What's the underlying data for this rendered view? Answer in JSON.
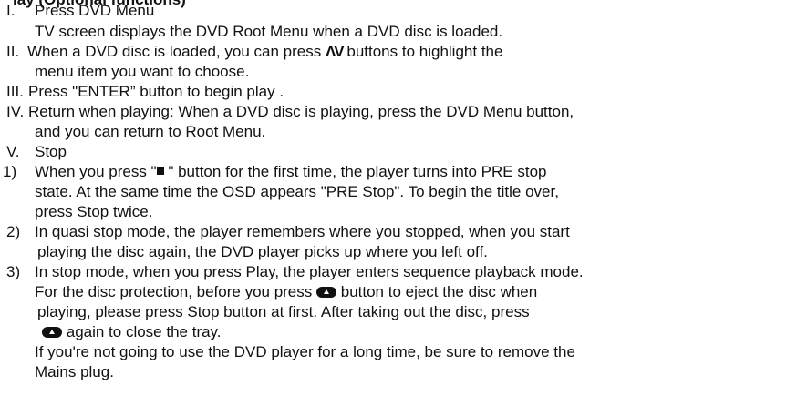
{
  "heading_fragment": "lay (Optional functions)",
  "lines": {
    "l1_num": "I.",
    "l1_text": "Press DVD Menu",
    "l2_text": "TV screen displays the DVD Root  Menu when a DVD disc is loaded.",
    "l3_num": "II.",
    "l3_a": "When a  DVD disc is loaded, you  can  press",
    "l3_icon": "ΛV",
    "l3_b": "buttons to highlight  the",
    "l4_text": "menu item you want  to choose.",
    "l5_num": "III.",
    "l5_text": "Press \"ENTER” button to begin play .",
    "l6_num": "IV.",
    "l6_text": "Return when playing: When a DVD disc is playing, press the  DVD Menu button,",
    "l7_text": "and you can return  to Root Menu.",
    "l8_num": "V.",
    "l8_text": "Stop",
    "l9_num": "1)",
    "l9_a": "When you press \"",
    "l9_b": " \" button for the first time, the player turns into PRE stop",
    "l10_text": "state. At the same  time the  OSD  appears \"PRE Stop\". To begin the title over,",
    "l11_text": "press Stop twice.",
    "l12_num": "2)",
    "l12_text": "In quasi stop  mode, the player remembers where you stopped, when you start",
    "l13_text": "playing the disc  again, the DVD player picks up where you left off.",
    "l14_num": "3)",
    "l14_text": "In stop mode, when you press Play, the player enters sequence playback mode.",
    "l15_a": "For the disc protection, before you press",
    "l15_b": "button to eject the disc  when",
    "l16_text": "playing, please press Stop button at first. After taking out the disc, press",
    "l17_b": "again to close the tray.",
    "l18_text": "If you're not  going to use the DVD player  for a long time, be sure to remove the",
    "l19_text": "Mains plug."
  }
}
